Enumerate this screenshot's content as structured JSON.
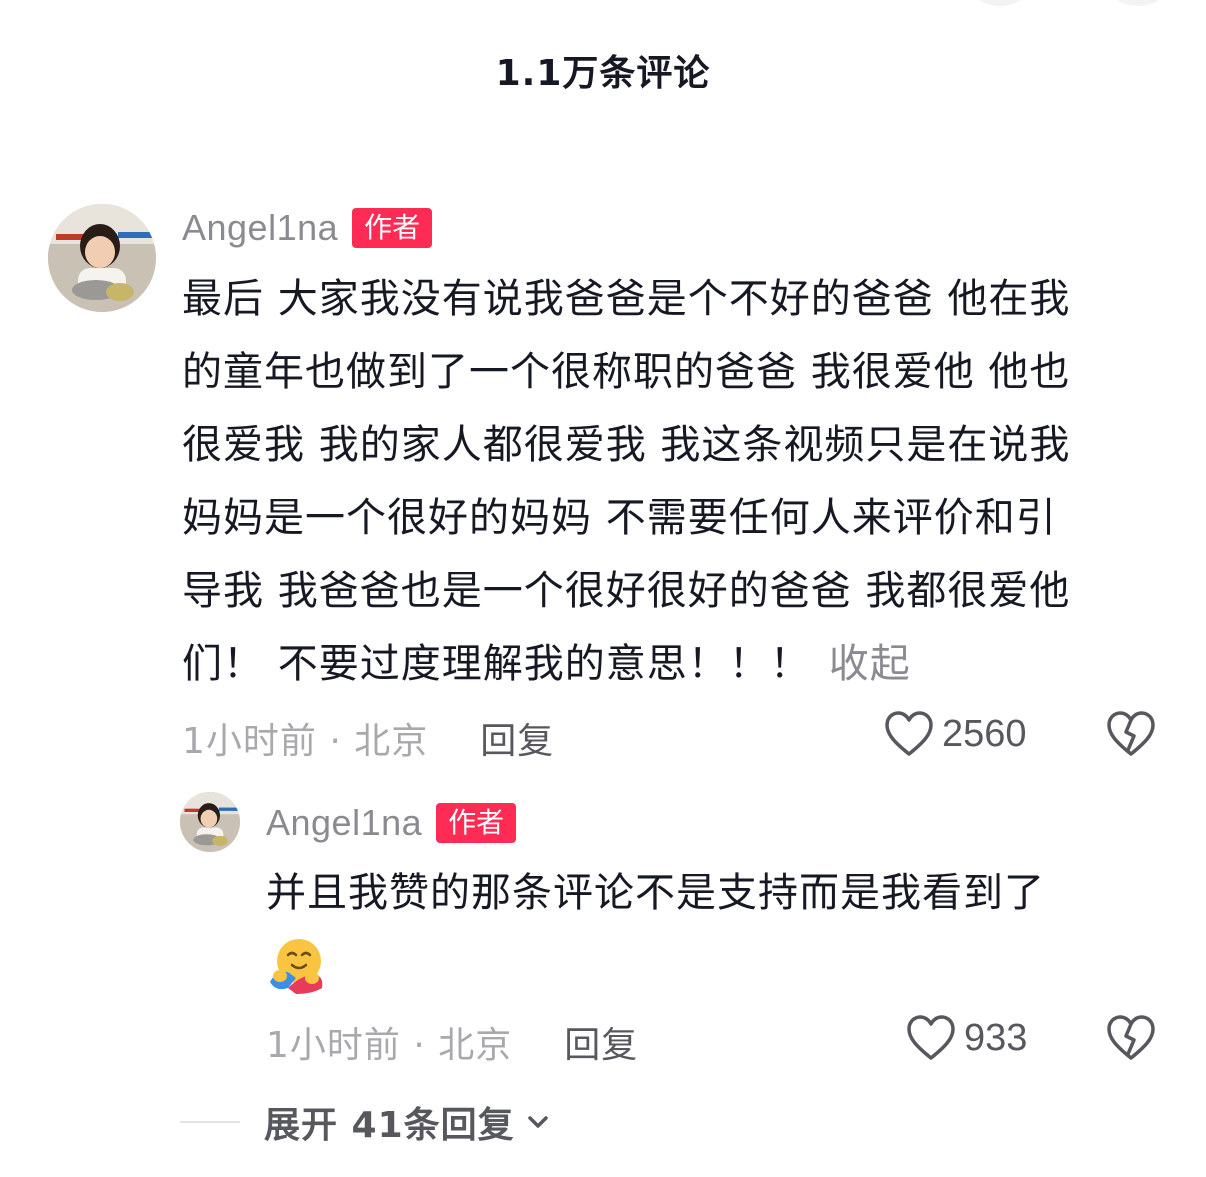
{
  "header": {
    "title": "1.1万条评论"
  },
  "comments": [
    {
      "username": "Angel1na",
      "badge": "作者",
      "text_lines": [
        "最后 大家我没有说我爸爸是个不好的爸爸 他在我",
        "的童年也做到了一个很称职的爸爸 我很爱他 他也",
        "很爱我 我的家人都很爱我 我这条视频只是在说我",
        "妈妈是一个很好的妈妈 不需要任何人来评价和引",
        "导我 我爸爸也是一个很好很好的爸爸 我都很爱他",
        "们！ 不要过度理解我的意思！！！"
      ],
      "collapse_label": "收起",
      "time_location": "1小时前 · 北京",
      "reply_label": "回复",
      "like_count": "2560",
      "icons": {
        "like": "heart-outline-icon",
        "dislike": "broken-heart-icon"
      }
    },
    {
      "username": "Angel1na",
      "badge": "作者",
      "text_lines": [
        "并且我赞的那条评论不是支持而是我看到了"
      ],
      "emoji": "🤗",
      "time_location": "1小时前 · 北京",
      "reply_label": "回复",
      "like_count": "933",
      "icons": {
        "like": "heart-outline-icon",
        "dislike": "broken-heart-icon"
      }
    }
  ],
  "expand_replies": {
    "label": "展开 41条回复",
    "icon": "chevron-down-icon"
  },
  "colors": {
    "badge": "#fe2c55",
    "text": "#161823",
    "muted": "#8a8b91"
  }
}
